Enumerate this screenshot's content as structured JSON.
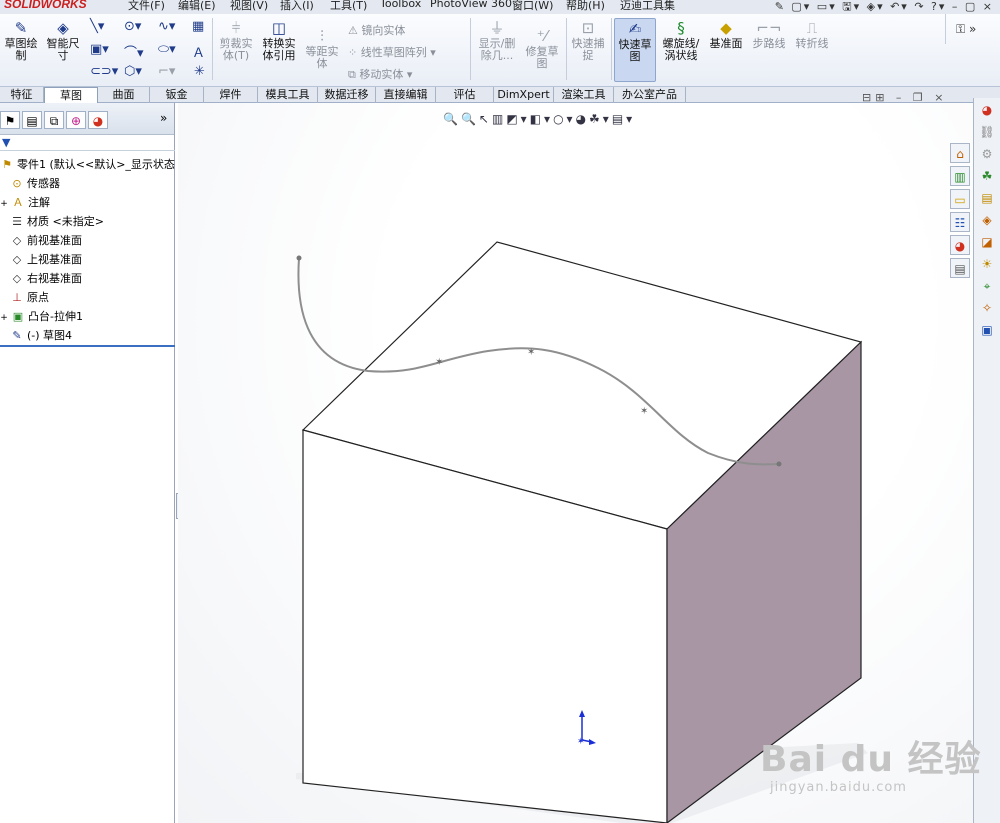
{
  "app": {
    "logo": "SOLIDWORKS"
  },
  "menu": [
    {
      "label": "文件(F)"
    },
    {
      "label": "编辑(E)"
    },
    {
      "label": "视图(V)"
    },
    {
      "label": "插入(I)"
    },
    {
      "label": "工具(T)"
    },
    {
      "label": "Toolbox"
    },
    {
      "label": "PhotoView 360"
    },
    {
      "label": "窗口(W)"
    },
    {
      "label": "帮助(H)"
    },
    {
      "label": "迈迪工具集"
    }
  ],
  "ribbon": {
    "sketch": "草图绘制",
    "smart_dim": "智能尺寸",
    "trim": "剪裁实体(T)",
    "convert": "转换实体引用",
    "offset": "等距实体",
    "mirror": "镜向实体",
    "linear_pattern": "线性草图阵列",
    "move": "移动实体",
    "show_delete": "显示/删除几...",
    "repair": "修复草图",
    "quick_snap": "快速捕捉",
    "rapid_sketch": "快速草图",
    "helix": "螺旋线/涡状线",
    "plane": "基准面",
    "step_line": "步路线",
    "jog_line": "转折线"
  },
  "tabs": [
    {
      "label": "特征"
    },
    {
      "label": "草图",
      "active": true
    },
    {
      "label": "曲面"
    },
    {
      "label": "钣金"
    },
    {
      "label": "焊件"
    },
    {
      "label": "模具工具"
    },
    {
      "label": "数据迁移"
    },
    {
      "label": "直接编辑"
    },
    {
      "label": "评估"
    },
    {
      "label": "DimXpert"
    },
    {
      "label": "渲染工具"
    },
    {
      "label": "办公室产品"
    }
  ],
  "tree": [
    {
      "label": "零件1 (默认<<默认>_显示状态",
      "icon": "part-icon"
    },
    {
      "label": "传感器",
      "icon": "sensor-icon"
    },
    {
      "label": "注解",
      "icon": "annotation-icon"
    },
    {
      "label": "材质 <未指定>",
      "icon": "material-icon"
    },
    {
      "label": "前视基准面",
      "icon": "plane-icon"
    },
    {
      "label": "上视基准面",
      "icon": "plane-icon"
    },
    {
      "label": "右视基准面",
      "icon": "plane-icon"
    },
    {
      "label": "原点",
      "icon": "origin-icon"
    },
    {
      "label": "凸台-拉伸1",
      "icon": "boss-extrude-icon"
    },
    {
      "label": "(-) 草图4",
      "icon": "sketch-icon"
    }
  ],
  "watermark": {
    "brand": "Bai du 经验",
    "url": "jingyan.baidu.com"
  },
  "colors": {
    "cube_right_face": "#a896a5",
    "cube_front_face": "#ffffff",
    "spline": "#8e8e8e"
  }
}
